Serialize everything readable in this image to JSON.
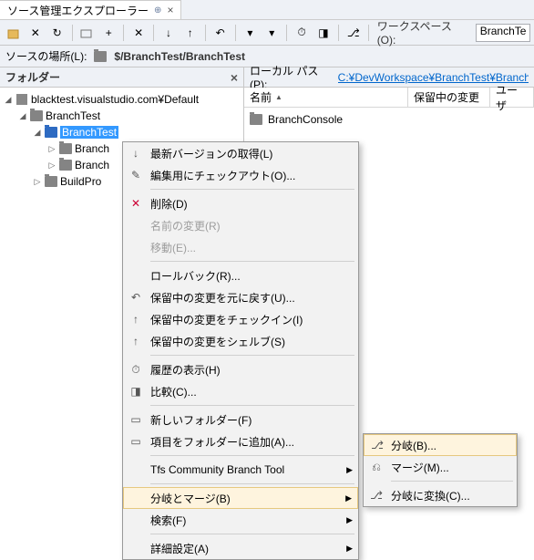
{
  "tab": {
    "title": "ソース管理エクスプローラー"
  },
  "toolbar": {
    "workspace_label": "ワークスペース(O):",
    "workspace_value": "BranchTe"
  },
  "source_location": {
    "label": "ソースの場所(L):",
    "value": "$/BranchTest/BranchTest"
  },
  "left_panel": {
    "title": "フォルダー"
  },
  "tree": {
    "root": "blacktest.visualstudio.com¥Default",
    "items": [
      "BranchTest",
      "BranchTest",
      "Branch",
      "Branch",
      "BuildPro"
    ]
  },
  "local_path": {
    "label": "ローカル パス(P):",
    "value": "C:¥DevWorkspace¥BranchTest¥BranchT"
  },
  "list": {
    "cols": {
      "name": "名前",
      "pending": "保留中の変更",
      "user": "ユーザ"
    },
    "items": [
      "BranchConsole"
    ]
  },
  "ctx": {
    "get_latest": "最新バージョンの取得(L)",
    "checkout": "編集用にチェックアウト(O)...",
    "delete": "削除(D)",
    "rename": "名前の変更(R)",
    "move": "移動(E)...",
    "rollback": "ロールバック(R)...",
    "undo": "保留中の変更を元に戻す(U)...",
    "checkin": "保留中の変更をチェックイン(I)",
    "shelve": "保留中の変更をシェルブ(S)",
    "history": "履歴の表示(H)",
    "compare": "比較(C)...",
    "newfolder": "新しいフォルダー(F)",
    "additems": "項目をフォルダーに追加(A)...",
    "tfs_tool": "Tfs Community Branch Tool",
    "branchmerge": "分岐とマージ(B)",
    "search": "検索(F)",
    "advanced": "詳細設定(A)"
  },
  "ctx_sub": {
    "branch": "分岐(B)...",
    "merge": "マージ(M)...",
    "convert": "分岐に変換(C)..."
  }
}
